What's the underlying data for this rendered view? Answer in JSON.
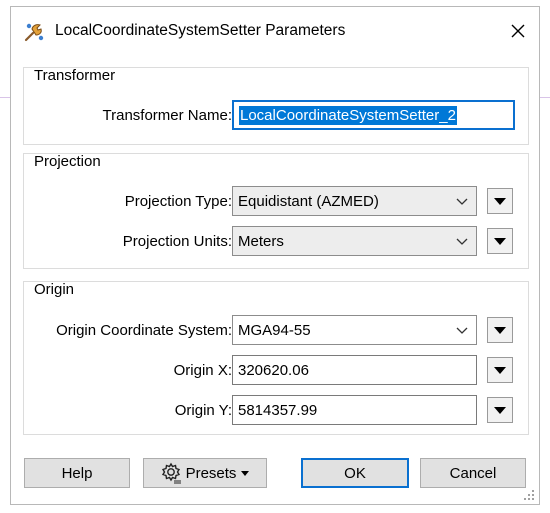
{
  "window": {
    "title": "LocalCoordinateSystemSetter Parameters",
    "app_icon": "transformer-icon",
    "close_icon": "close-icon"
  },
  "transformer_group": {
    "label": "Transformer",
    "name_label": "Transformer Name:",
    "name_value": "LocalCoordinateSystemSetter_2"
  },
  "projection_group": {
    "label": "Projection",
    "type_label": "Projection Type:",
    "type_value": "Equidistant (AZMED)",
    "units_label": "Projection Units:",
    "units_value": "Meters"
  },
  "origin_group": {
    "label": "Origin",
    "cs_label": "Origin Coordinate System:",
    "cs_value": "MGA94-55",
    "x_label": "Origin X:",
    "x_value": "320620.06",
    "y_label": "Origin Y:",
    "y_value": "5814357.99"
  },
  "buttons": {
    "help": "Help",
    "presets": "Presets",
    "ok": "OK",
    "cancel": "Cancel"
  },
  "colors": {
    "accent": "#0078d7",
    "focus_border": "#0a70d0"
  }
}
